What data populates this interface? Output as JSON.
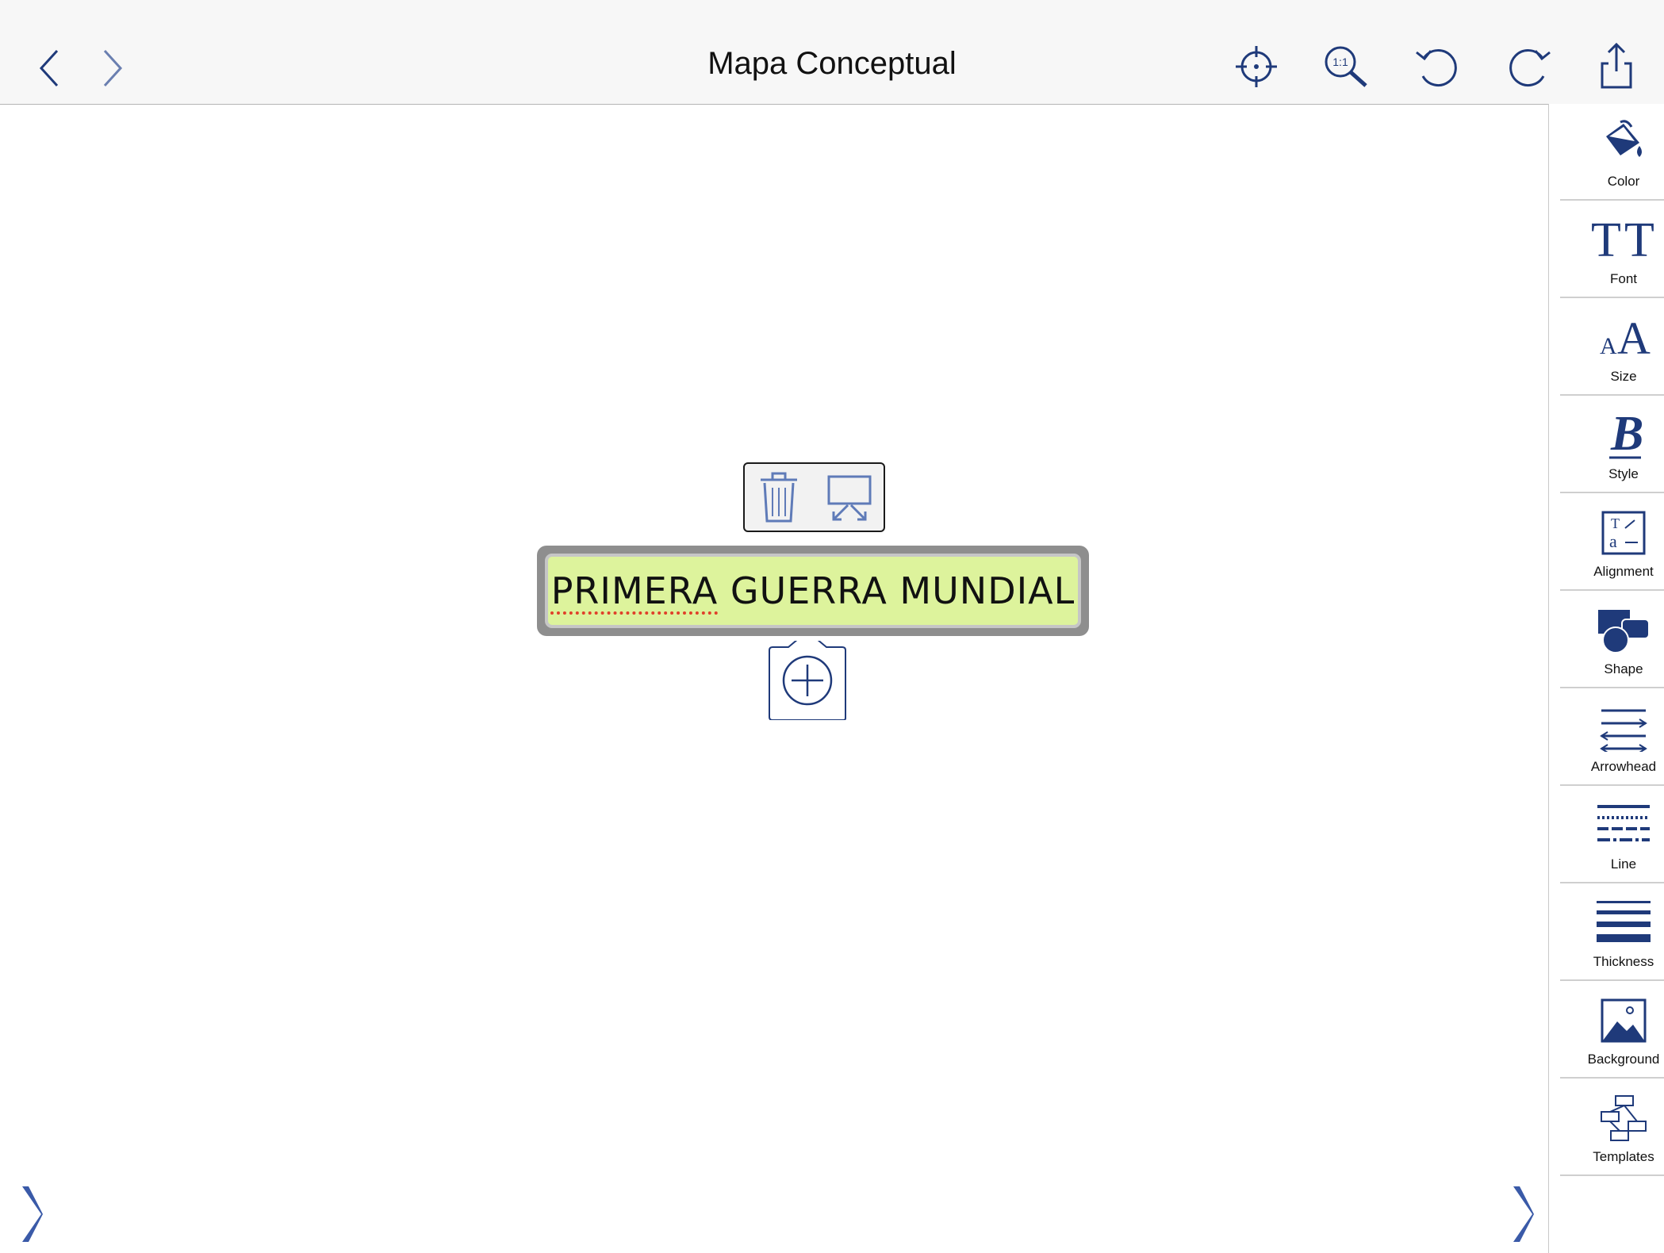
{
  "header": {
    "title": "Mapa Conceptual",
    "back_icon": "chevron-left-icon",
    "forward_icon": "chevron-right-icon",
    "actions": [
      "locate-icon",
      "zoom-1-1-icon",
      "undo-icon",
      "redo-icon",
      "share-icon"
    ],
    "zoom_label": "1:1"
  },
  "canvas": {
    "node": {
      "text_spell": "PRIMERA",
      "text_rest": " GUERRA MUNDIAL",
      "fill_color": "#ddf39c",
      "border_color": "#8e8e8e"
    },
    "node_toolbar": [
      "trash-icon",
      "presentation-icon"
    ],
    "add_child_icon": "plus-circle-icon"
  },
  "sidebar": {
    "items": [
      {
        "label": "Color",
        "icon": "paint-bucket-icon"
      },
      {
        "label": "Font",
        "icon": "font-icon"
      },
      {
        "label": "Size",
        "icon": "text-size-icon"
      },
      {
        "label": "Style",
        "icon": "bold-icon"
      },
      {
        "label": "Alignment",
        "icon": "alignment-icon"
      },
      {
        "label": "Shape",
        "icon": "shape-icon"
      },
      {
        "label": "Arrowhead",
        "icon": "arrowhead-icon"
      },
      {
        "label": "Line",
        "icon": "line-style-icon"
      },
      {
        "label": "Thickness",
        "icon": "thickness-icon"
      },
      {
        "label": "Background",
        "icon": "background-image-icon"
      },
      {
        "label": "Templates",
        "icon": "templates-icon"
      }
    ]
  },
  "colors": {
    "accent": "#1f3a7a",
    "node_fill": "#ddf39c"
  }
}
